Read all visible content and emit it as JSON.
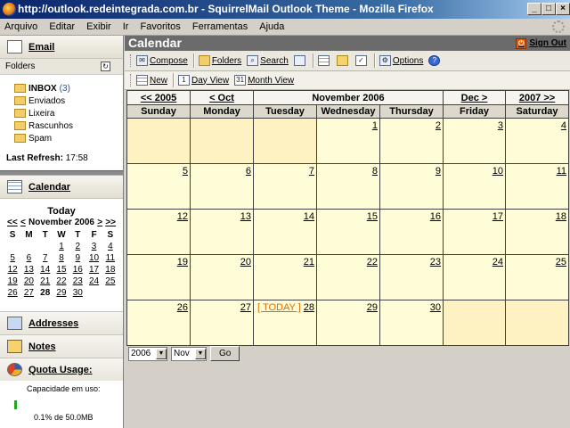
{
  "window": {
    "title": "http://outlook.redeintegrada.com.br - SquirrelMail Outlook Theme - Mozilla Firefox"
  },
  "menu": [
    "Arquivo",
    "Editar",
    "Exibir",
    "Ir",
    "Favoritos",
    "Ferramentas",
    "Ajuda"
  ],
  "sidebar": {
    "email_label": "Email",
    "folders_label": "Folders",
    "folders": [
      {
        "name": "INBOX",
        "count": "(3)",
        "bold": true
      },
      {
        "name": "Enviados"
      },
      {
        "name": "Lixeira"
      },
      {
        "name": "Rascunhos"
      },
      {
        "name": "Spam"
      }
    ],
    "refresh_label": "Last Refresh:",
    "refresh_time": "17:58",
    "calendar_label": "Calendar",
    "mini": {
      "today_label": "Today",
      "prev_year": "<<",
      "prev_month": "<",
      "month_title": "November 2006",
      "next_month": ">",
      "next_year": ">>",
      "days": [
        "S",
        "M",
        "T",
        "W",
        "T",
        "F",
        "S"
      ],
      "weeks": [
        [
          "",
          "",
          "",
          "1",
          "2",
          "3",
          "4"
        ],
        [
          "5",
          "6",
          "7",
          "8",
          "9",
          "10",
          "11"
        ],
        [
          "12",
          "13",
          "14",
          "15",
          "16",
          "17",
          "18"
        ],
        [
          "19",
          "20",
          "21",
          "22",
          "23",
          "24",
          "25"
        ],
        [
          "26",
          "27",
          "28",
          "29",
          "30",
          "",
          ""
        ]
      ],
      "today_day": "28"
    },
    "addresses_label": "Addresses",
    "notes_label": "Notes",
    "quota_label": "Quota Usage:",
    "quota_caption": "Capacidade em uso:",
    "quota_text": "0.1% de 50.0MB",
    "quota_fraction": 0.001
  },
  "header": {
    "title": "Calendar",
    "signout": "Sign Out"
  },
  "toolbar": {
    "compose": "Compose",
    "folders": "Folders",
    "search": "Search",
    "options": "Options"
  },
  "cal_toolbar": {
    "new": "New",
    "day_view": "Day View",
    "month_view": "Month View"
  },
  "calendar": {
    "prev_year": "<< 2005",
    "prev_month": "< Oct",
    "title": "November 2006",
    "next_month": "Dec >",
    "next_year": "2007 >>",
    "days": [
      "Sunday",
      "Monday",
      "Tuesday",
      "Wednesday",
      "Thursday",
      "Friday",
      "Saturday"
    ],
    "weeks": [
      [
        "",
        "",
        "",
        "1",
        "2",
        "3",
        "4"
      ],
      [
        "5",
        "6",
        "7",
        "8",
        "9",
        "10",
        "11"
      ],
      [
        "12",
        "13",
        "14",
        "15",
        "16",
        "17",
        "18"
      ],
      [
        "19",
        "20",
        "21",
        "22",
        "23",
        "24",
        "25"
      ],
      [
        "26",
        "27",
        "28",
        "29",
        "30",
        "",
        ""
      ]
    ],
    "today_day": "28",
    "today_label": "[ TODAY ]"
  },
  "controls": {
    "year_value": "2006",
    "month_value": "Nov",
    "go_label": "Go"
  }
}
